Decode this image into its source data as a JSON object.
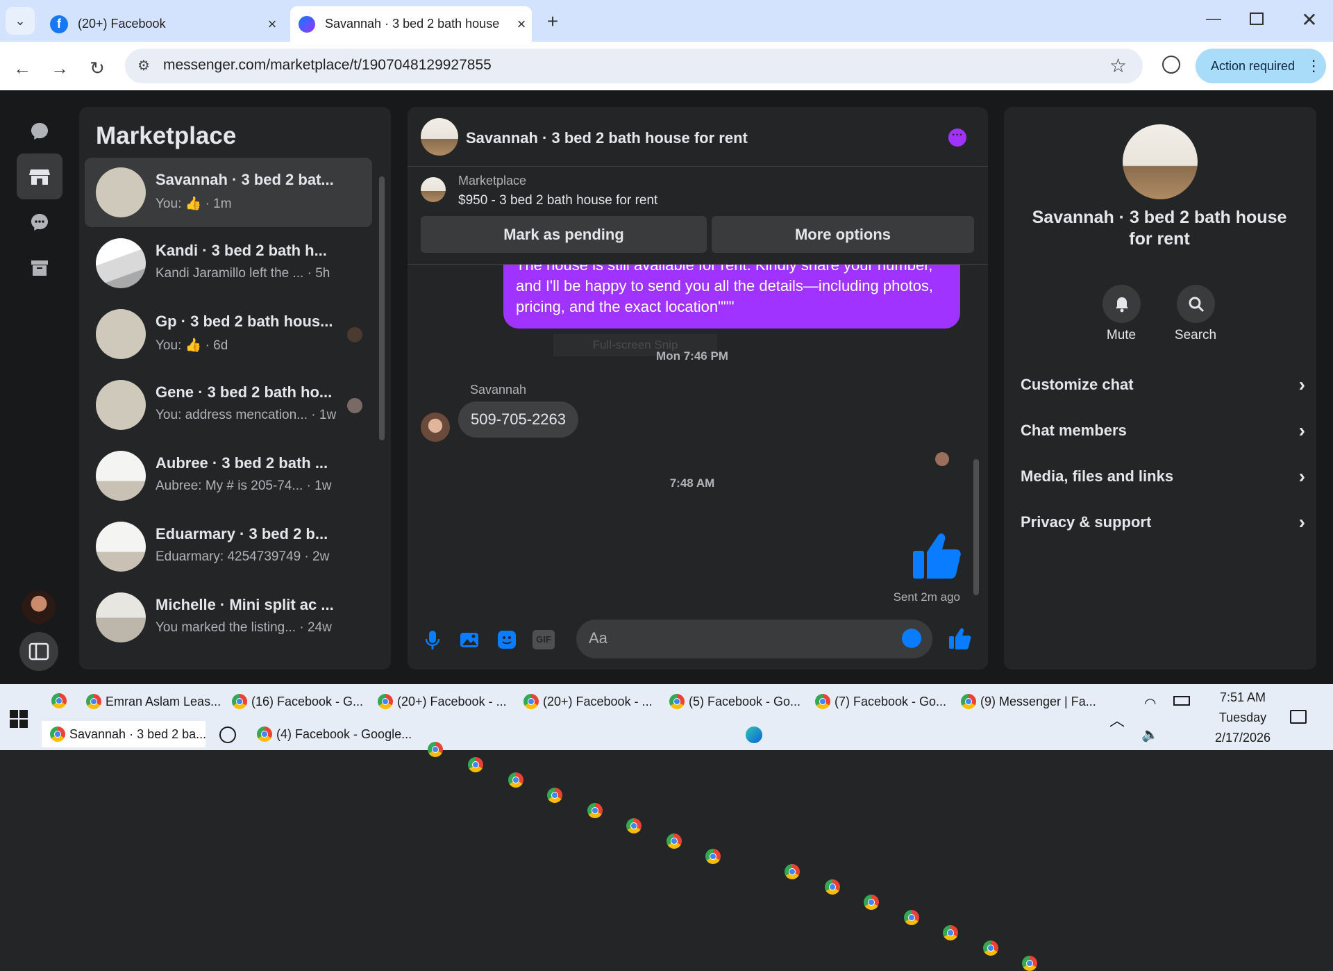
{
  "browser": {
    "tabs": [
      {
        "title": "(20+) Facebook"
      },
      {
        "title": "Savannah · 3 bed 2 bath house"
      }
    ],
    "url": "messenger.com/marketplace/t/1907048129927855",
    "action_label": "Action required"
  },
  "messenger": {
    "list_title": "Marketplace",
    "conversations": [
      {
        "name": "Savannah · 3 bed 2 bat...",
        "preview": "You:",
        "time": "· 1m"
      },
      {
        "name": "Kandi · 3 bed 2 bath h...",
        "preview": "Kandi Jaramillo left the ...",
        "time": "· 5h"
      },
      {
        "name": "Gp · 3 bed 2 bath hous...",
        "preview": "You:",
        "time": "· 6d"
      },
      {
        "name": "Gene · 3 bed 2 bath ho...",
        "preview": "You: address mencation...",
        "time": "· 1w"
      },
      {
        "name": "Aubree · 3 bed 2 bath ...",
        "preview": "Aubree: My # is 205-74...",
        "time": "· 1w"
      },
      {
        "name": "Eduarmary · 3 bed 2 b...",
        "preview": "Eduarmary: 4254739749",
        "time": "· 2w"
      },
      {
        "name": "Michelle · Mini split ac ...",
        "preview": "You marked the listing...",
        "time": "· 24w"
      }
    ],
    "chat": {
      "title": "Savannah · 3 bed 2 bath house for rent",
      "listing_source": "Marketplace",
      "listing_title": "$950 - 3 bed 2 bath house for rent",
      "mark_pending": "Mark as pending",
      "more_options": "More options",
      "messages": {
        "outgoing_text": "The house is still available for rent. Kindly share your number, and I'll be happy to send you all the details—including photos, pricing, and the exact location\"\"\"",
        "snip_overlay": "Full-screen Snip",
        "timestamp_1": "Mon 7:46 PM",
        "sender_name": "Savannah",
        "incoming_text": "509-705-2263",
        "timestamp_2": "7:48 AM",
        "sent_status": "Sent 2m ago"
      },
      "composer_placeholder": "Aa",
      "accent": "#a033ff"
    },
    "details": {
      "title": "Savannah · 3 bed 2 bath house for rent",
      "mute_label": "Mute",
      "search_label": "Search",
      "menu": [
        "Customize chat",
        "Chat members",
        "Media, files and links",
        "Privacy & support"
      ]
    }
  },
  "taskbar": {
    "row1": [
      "Emran Aslam Leas...",
      "(16) Facebook - G...",
      "(20+) Facebook - ...",
      "(20+) Facebook - ...",
      "(5) Facebook - Go...",
      "(7) Facebook - Go...",
      "(9) Messenger | Fa..."
    ],
    "row2": [
      "Savannah · 3 bed 2 ba...",
      "(4) Facebook - Google..."
    ],
    "clock": {
      "time": "7:51 AM",
      "day": "Tuesday",
      "date": "2/17/2026"
    }
  }
}
